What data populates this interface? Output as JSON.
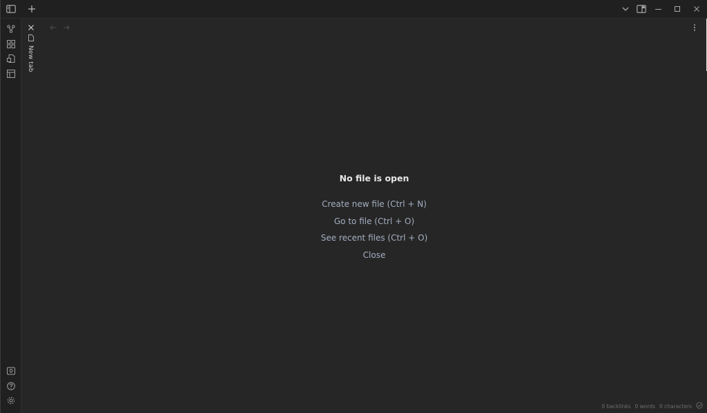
{
  "titlebar": {
    "icons": [
      "sidebar-toggle-icon",
      "new-tab-icon",
      "chevron-down-icon",
      "split-view-icon",
      "minimize-icon",
      "maximize-icon",
      "close-icon"
    ]
  },
  "ribbon": {
    "top_icons": [
      "graph-view-icon",
      "canvas-icon",
      "template-icon",
      "layout-icon"
    ],
    "bottom_icons": [
      "vault-icon",
      "help-icon",
      "settings-icon"
    ]
  },
  "tabs": [
    {
      "label": "New tab",
      "active": true
    }
  ],
  "main": {
    "empty_title": "No file is open",
    "actions": [
      {
        "label": "Create new file (Ctrl + N)"
      },
      {
        "label": "Go to file (Ctrl + O)"
      },
      {
        "label": "See recent files (Ctrl + O)"
      },
      {
        "label": "Close"
      }
    ]
  },
  "statusbar": {
    "backlinks": "0 backlinks",
    "words": "0 words",
    "characters": "0 characters"
  },
  "colors": {
    "background": "#262626",
    "titlebar": "#202020",
    "link": "#a4afc2",
    "heading": "#e6e6e6"
  }
}
